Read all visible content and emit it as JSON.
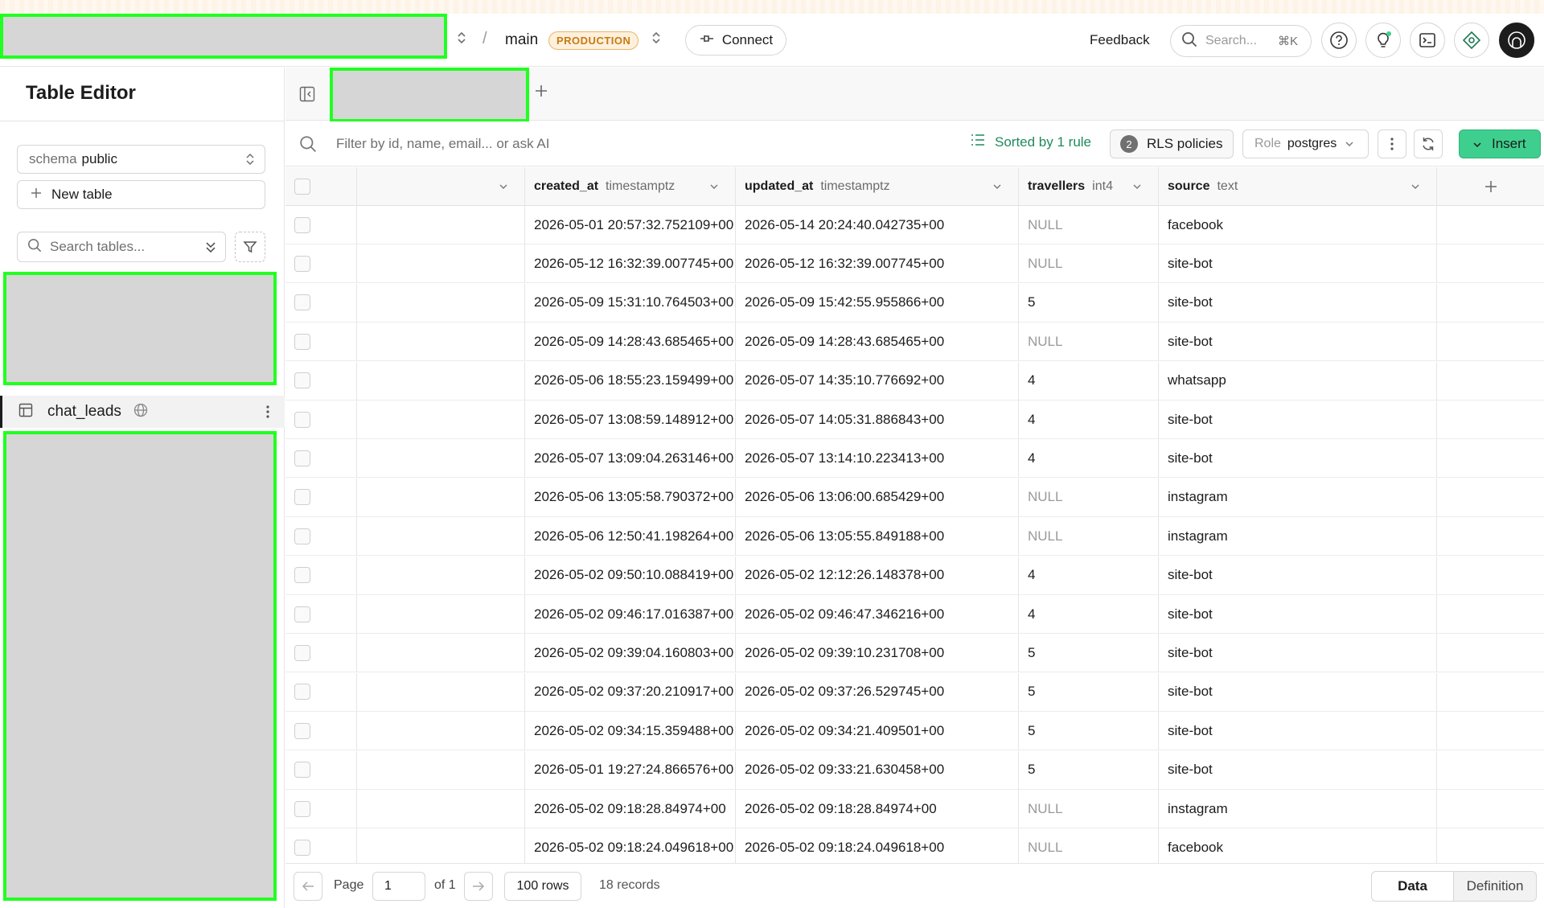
{
  "topbar": {
    "branch": "main",
    "env_badge": "PRODUCTION",
    "connect_label": "Connect",
    "feedback_label": "Feedback",
    "search_placeholder": "Search...",
    "search_shortcut": "⌘K"
  },
  "sidebar": {
    "title": "Table Editor",
    "schema_prefix": "schema",
    "schema_value": "public",
    "new_table_label": "New table",
    "search_placeholder": "Search tables...",
    "active_table": "chat_leads"
  },
  "filterbar": {
    "placeholder": "Filter by id, name, email... or ask AI",
    "sorted_label": "Sorted by 1 rule",
    "rls_count": "2",
    "rls_label": "RLS policies",
    "role_prefix": "Role",
    "role_value": "postgres",
    "insert_label": "Insert"
  },
  "columns": [
    {
      "name": "created_at",
      "type": "timestamptz"
    },
    {
      "name": "updated_at",
      "type": "timestamptz"
    },
    {
      "name": "travellers",
      "type": "int4"
    },
    {
      "name": "source",
      "type": "text"
    }
  ],
  "rows": [
    {
      "created_at": "2026-05-01 20:57:32.752109+00",
      "updated_at": "2026-05-14 20:24:40.042735+00",
      "travellers": "NULL",
      "source": "facebook"
    },
    {
      "created_at": "2026-05-12 16:32:39.007745+00",
      "updated_at": "2026-05-12 16:32:39.007745+00",
      "travellers": "NULL",
      "source": "site-bot"
    },
    {
      "created_at": "2026-05-09 15:31:10.764503+00",
      "updated_at": "2026-05-09 15:42:55.955866+00",
      "travellers": "5",
      "source": "site-bot"
    },
    {
      "created_at": "2026-05-09 14:28:43.685465+00",
      "updated_at": "2026-05-09 14:28:43.685465+00",
      "travellers": "NULL",
      "source": "site-bot"
    },
    {
      "created_at": "2026-05-06 18:55:23.159499+00",
      "updated_at": "2026-05-07 14:35:10.776692+00",
      "travellers": "4",
      "source": "whatsapp"
    },
    {
      "created_at": "2026-05-07 13:08:59.148912+00",
      "updated_at": "2026-05-07 14:05:31.886843+00",
      "travellers": "4",
      "source": "site-bot"
    },
    {
      "created_at": "2026-05-07 13:09:04.263146+00",
      "updated_at": "2026-05-07 13:14:10.223413+00",
      "travellers": "4",
      "source": "site-bot"
    },
    {
      "created_at": "2026-05-06 13:05:58.790372+00",
      "updated_at": "2026-05-06 13:06:00.685429+00",
      "travellers": "NULL",
      "source": "instagram"
    },
    {
      "created_at": "2026-05-06 12:50:41.198264+00",
      "updated_at": "2026-05-06 13:05:55.849188+00",
      "travellers": "NULL",
      "source": "instagram"
    },
    {
      "created_at": "2026-05-02 09:50:10.088419+00",
      "updated_at": "2026-05-02 12:12:26.148378+00",
      "travellers": "4",
      "source": "site-bot"
    },
    {
      "created_at": "2026-05-02 09:46:17.016387+00",
      "updated_at": "2026-05-02 09:46:47.346216+00",
      "travellers": "4",
      "source": "site-bot"
    },
    {
      "created_at": "2026-05-02 09:39:04.160803+00",
      "updated_at": "2026-05-02 09:39:10.231708+00",
      "travellers": "5",
      "source": "site-bot"
    },
    {
      "created_at": "2026-05-02 09:37:20.210917+00",
      "updated_at": "2026-05-02 09:37:26.529745+00",
      "travellers": "5",
      "source": "site-bot"
    },
    {
      "created_at": "2026-05-02 09:34:15.359488+00",
      "updated_at": "2026-05-02 09:34:21.409501+00",
      "travellers": "5",
      "source": "site-bot"
    },
    {
      "created_at": "2026-05-01 19:27:24.866576+00",
      "updated_at": "2026-05-02 09:33:21.630458+00",
      "travellers": "5",
      "source": "site-bot"
    },
    {
      "created_at": "2026-05-02 09:18:28.84974+00",
      "updated_at": "2026-05-02 09:18:28.84974+00",
      "travellers": "NULL",
      "source": "instagram"
    },
    {
      "created_at": "2026-05-02 09:18:24.049618+00",
      "updated_at": "2026-05-02 09:18:24.049618+00",
      "travellers": "NULL",
      "source": "facebook"
    }
  ],
  "footer": {
    "page_label": "Page",
    "page_value": "1",
    "of_label": "of 1",
    "rows_label": "100 rows",
    "records_label": "18 records",
    "tab_data": "Data",
    "tab_definition": "Definition"
  }
}
